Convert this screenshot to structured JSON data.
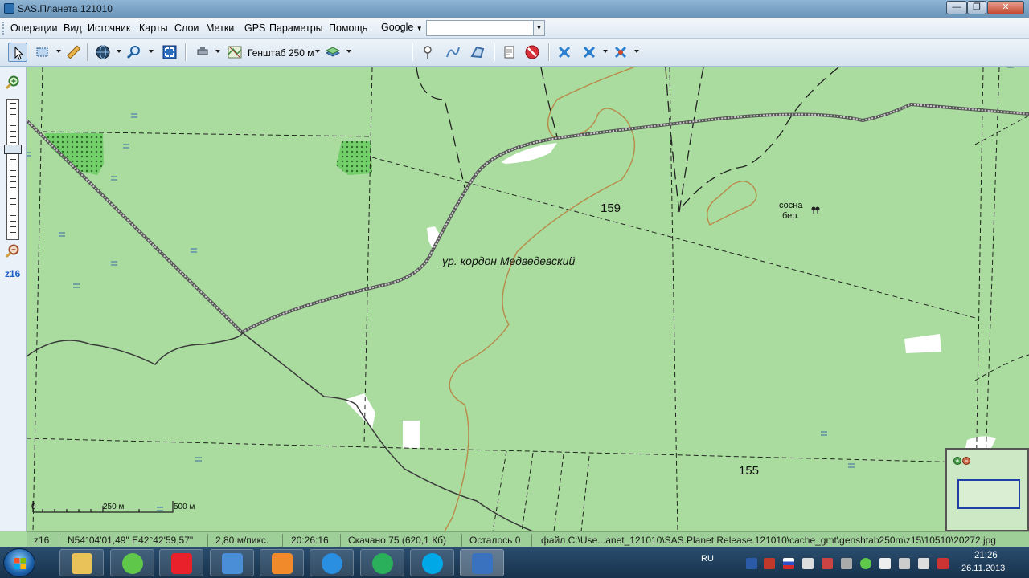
{
  "window": {
    "title": "SAS.Планета 121010",
    "minimize": "—",
    "maximize": "❐",
    "close": "✕"
  },
  "menu": {
    "items": [
      "Операции",
      "Вид",
      "Источник",
      "Карты",
      "Слои",
      "Метки",
      "GPS",
      "Параметры",
      "Помощь"
    ],
    "search_engine": "Google",
    "search_value": ""
  },
  "toolbar": {
    "map_name": "Генштаб 250 м"
  },
  "left_panel": {
    "zoom_in": "zoom-in",
    "zoom_out": "zoom-out",
    "zoom_level": "z16"
  },
  "map": {
    "labels": {
      "hill_159": "159",
      "hill_155": "155",
      "tract": "ур. кордон Медведевский",
      "forest_1": "сосна",
      "forest_2": "бер."
    },
    "scale": {
      "zero": "0",
      "mid": "250 м",
      "end": "500 м"
    }
  },
  "status": {
    "zoom": "z16",
    "coords": "N54°04'01,49\" E42°42'59,57\"",
    "resolution": "2,80 м/пикс.",
    "time": "20:26:16",
    "downloaded": "Скачано 75 (620,1 Кб)",
    "remaining": "Осталось 0",
    "file": "файл C:\\Use...anet_121010\\SAS.Planet.Release.121010\\cache_gmt\\genshtab250m\\z15\\10510\\20272.jpg"
  },
  "taskbar": {
    "lang": "RU",
    "time": "21:26",
    "date": "26.11.2013"
  },
  "colors": {
    "map_bg": "#a9dc9e",
    "forest_green": "#6fd16a",
    "road": "#555555",
    "contour": "#b88a4a"
  }
}
